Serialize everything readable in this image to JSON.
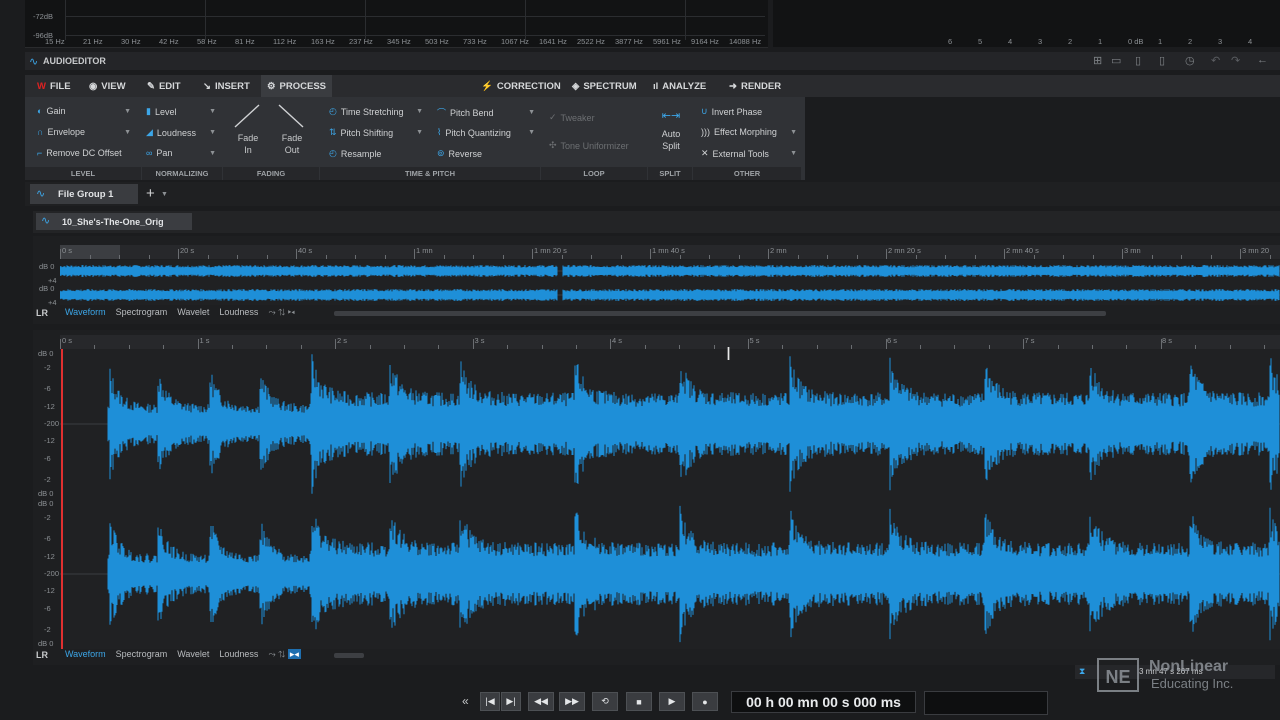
{
  "spectrum": {
    "db_labels": [
      "-72dB",
      "-96dB"
    ],
    "freq_labels": [
      "15 Hz",
      "21 Hz",
      "30 Hz",
      "42 Hz",
      "58 Hz",
      "81 Hz",
      "112 Hz",
      "163 Hz",
      "237 Hz",
      "345 Hz",
      "503 Hz",
      "733 Hz",
      "1067 Hz",
      "1641 Hz",
      "2522 Hz",
      "3877 Hz",
      "5961 Hz",
      "9164 Hz",
      "14088 Hz"
    ],
    "meter_labels": [
      "6",
      "5",
      "4",
      "3",
      "2",
      "1",
      "0 dB",
      "1",
      "2",
      "3",
      "4"
    ]
  },
  "editor": {
    "title": "AUDIOEDITOR"
  },
  "tabs": {
    "left": [
      {
        "label": "FILE",
        "icon": "wavelab-logo-icon"
      },
      {
        "label": "VIEW",
        "icon": "eye-icon"
      },
      {
        "label": "EDIT",
        "icon": "edit-icon"
      },
      {
        "label": "INSERT",
        "icon": "insert-icon"
      },
      {
        "label": "PROCESS",
        "icon": "gears-icon"
      }
    ],
    "center": [
      {
        "label": "CORRECTION",
        "icon": "bolt-icon"
      },
      {
        "label": "SPECTRUM",
        "icon": "spectrum-icon"
      },
      {
        "label": "ANALYZE",
        "icon": "analyze-icon"
      },
      {
        "label": "RENDER",
        "icon": "render-icon"
      }
    ]
  },
  "ribbon": {
    "level": {
      "items": [
        "Gain",
        "Envelope",
        "Remove DC Offset"
      ],
      "group": "LEVEL"
    },
    "normalizing": {
      "items": [
        "Level",
        "Loudness",
        "Pan"
      ],
      "group": "NORMALIZING"
    },
    "fading": {
      "fade_in": [
        "Fade",
        "In"
      ],
      "fade_out": [
        "Fade",
        "Out"
      ],
      "group": "FADING"
    },
    "time_pitch": {
      "col1": [
        "Time Stretching",
        "Pitch Shifting",
        "Resample"
      ],
      "col2": [
        "Pitch Bend",
        "Pitch Quantizing",
        "Reverse"
      ],
      "group": "TIME & PITCH"
    },
    "loop": {
      "items": [
        "Tweaker",
        "Tone Uniformizer"
      ],
      "group": "LOOP"
    },
    "split": {
      "items": [
        "Auto",
        "Split"
      ],
      "group": "SPLIT"
    },
    "other": {
      "items": [
        "Invert Phase",
        "Effect Morphing",
        "External Tools"
      ],
      "group": "OTHER"
    }
  },
  "file_group": {
    "label": "File Group 1",
    "add": "+"
  },
  "file": {
    "name": "10_She's-The-One_Orig"
  },
  "overview": {
    "ruler": [
      "0 s",
      "20 s",
      "40 s",
      "1 mn",
      "1 mn 20 s",
      "1 mn 40 s",
      "2 mn",
      "2 mn 20 s",
      "2 mn 40 s",
      "3 mn",
      "3 mn 20"
    ],
    "db_labels": [
      "dB 0",
      "+4",
      "dB 0",
      "+4"
    ],
    "channel": "LR",
    "view_tabs": [
      "Waveform",
      "Spectrogram",
      "Wavelet",
      "Loudness"
    ]
  },
  "main": {
    "ruler": [
      "0 s",
      "1 s",
      "2 s",
      "3 s",
      "4 s",
      "5 s",
      "6 s",
      "7 s",
      "8 s"
    ],
    "db_top": [
      "dB 0",
      "-2",
      "-6",
      "-12",
      "-200",
      "-12",
      "-6",
      "-2",
      "dB 0"
    ],
    "db_bottom": [
      "dB 0",
      "-2",
      "-6",
      "-12",
      "-200",
      "-12",
      "-6",
      "-2",
      "dB 0"
    ],
    "channel": "LR",
    "view_tabs": [
      "Waveform",
      "Spectrogram",
      "Wavelet",
      "Loudness"
    ],
    "status": "3 mn 47 s 267 ms"
  },
  "transport": {
    "buttons": [
      "«",
      "|◀",
      "▶|",
      "◀◀",
      "▶▶",
      "⟲",
      "■",
      "▶",
      "●"
    ],
    "time": "00 h 00 mn 00 s 000 ms"
  },
  "watermark": {
    "logo": "NE",
    "line1": "NonLinear",
    "line2": "Educating Inc."
  },
  "colors": {
    "wave": "#1e8fd8",
    "accent": "#3ca6e8",
    "cursor": "#e03030"
  }
}
